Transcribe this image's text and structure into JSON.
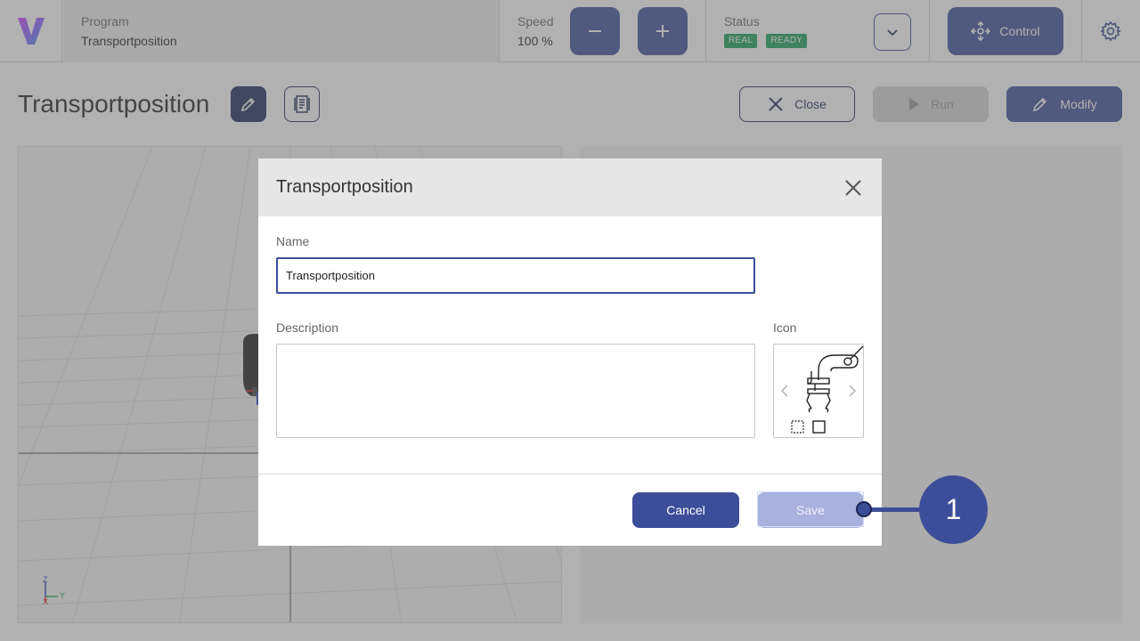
{
  "topbar": {
    "program": {
      "label": "Program",
      "value": "Transportposition"
    },
    "speed": {
      "label": "Speed",
      "value": "100 %",
      "decrease_icon": "minus-icon",
      "increase_icon": "plus-icon"
    },
    "status": {
      "label": "Status",
      "badges": [
        "REAL",
        "READY"
      ],
      "dropdown_icon": "chevron-down-icon"
    },
    "control": {
      "label": "Control",
      "icon": "move-arrows-icon"
    },
    "settings_icon": "gear-icon"
  },
  "page": {
    "title": "Transportposition",
    "actions": {
      "close": "Close",
      "run": "Run",
      "modify": "Modify"
    }
  },
  "viewport": {
    "axis_labels": {
      "z": "Z",
      "y": "Y",
      "x": "X"
    }
  },
  "dialog": {
    "title": "Transportposition",
    "name_label": "Name",
    "name_value": "Transportposition",
    "description_label": "Description",
    "description_value": "",
    "icon_label": "Icon",
    "cancel": "Cancel",
    "save": "Save"
  },
  "callout": {
    "number": "1"
  },
  "colors": {
    "primary": "#3c4e99",
    "dark": "#1f2a58",
    "ready_badge": "#18a05a",
    "save_disabled": "#a9b1dd"
  }
}
